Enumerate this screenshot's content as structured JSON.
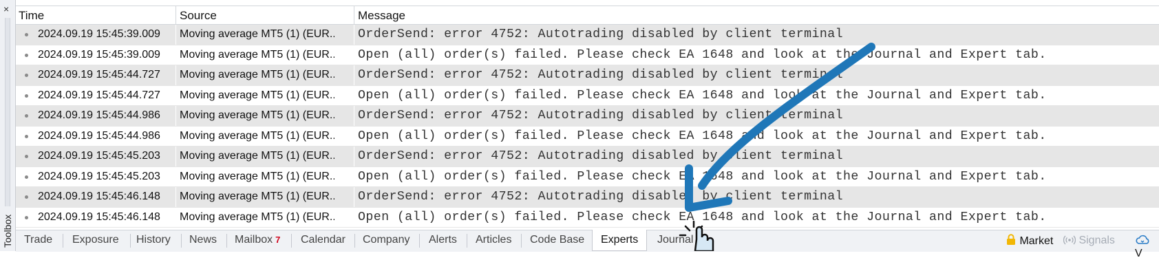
{
  "toolbox": {
    "close_glyph": "×",
    "label": "Toolbox"
  },
  "columns": {
    "time": "Time",
    "source": "Source",
    "message": "Message"
  },
  "rows": [
    {
      "time": "2024.09.19 15:45:39.009",
      "source": "Moving average MT5 (1) (EUR...",
      "message": "OrderSend: error 4752: Autotrading disabled by client terminal"
    },
    {
      "time": "2024.09.19 15:45:39.009",
      "source": "Moving average MT5 (1) (EUR...",
      "message": "Open (all) order(s) failed. Please check EA 1648 and look at the Journal and Expert tab."
    },
    {
      "time": "2024.09.19 15:45:44.727",
      "source": "Moving average MT5 (1) (EUR...",
      "message": "OrderSend: error 4752: Autotrading disabled by client terminal"
    },
    {
      "time": "2024.09.19 15:45:44.727",
      "source": "Moving average MT5 (1) (EUR...",
      "message": "Open (all) order(s) failed. Please check EA 1648 and look at the Journal and Expert tab."
    },
    {
      "time": "2024.09.19 15:45:44.986",
      "source": "Moving average MT5 (1) (EUR...",
      "message": "OrderSend: error 4752: Autotrading disabled by client terminal"
    },
    {
      "time": "2024.09.19 15:45:44.986",
      "source": "Moving average MT5 (1) (EUR...",
      "message": "Open (all) order(s) failed. Please check EA 1648 and look at the Journal and Expert tab."
    },
    {
      "time": "2024.09.19 15:45:45.203",
      "source": "Moving average MT5 (1) (EUR...",
      "message": "OrderSend: error 4752: Autotrading disabled by client terminal"
    },
    {
      "time": "2024.09.19 15:45:45.203",
      "source": "Moving average MT5 (1) (EUR...",
      "message": "Open (all) order(s) failed. Please check EA 1648 and look at the Journal and Expert tab."
    },
    {
      "time": "2024.09.19 15:45:46.148",
      "source": "Moving average MT5 (1) (EUR...",
      "message": "OrderSend: error 4752: Autotrading disabled by client terminal"
    },
    {
      "time": "2024.09.19 15:45:46.148",
      "source": "Moving average MT5 (1) (EUR...",
      "message": "Open (all) order(s) failed. Please check EA 1648 and look at the Journal and Expert tab."
    }
  ],
  "tabs": {
    "trade": "Trade",
    "exposure": "Exposure",
    "history": "History",
    "news": "News",
    "mailbox": "Mailbox",
    "mailbox_count": "7",
    "calendar": "Calendar",
    "company": "Company",
    "alerts": "Alerts",
    "articles": "Articles",
    "codebase": "Code Base",
    "experts": "Experts",
    "journal": "Journal"
  },
  "right_tabs": {
    "market": "Market",
    "signals": "Signals",
    "vps": "V"
  },
  "icons": {
    "market": "lock-icon",
    "signals": "signal-icon",
    "vps": "cloud-icon",
    "overlay_arrow": "arrow-annotation",
    "cursor": "hand-cursor-icon"
  },
  "colors": {
    "arrow": "#1f77b8",
    "badge": "#d0021b",
    "row_alt": "#e6e6e6"
  }
}
